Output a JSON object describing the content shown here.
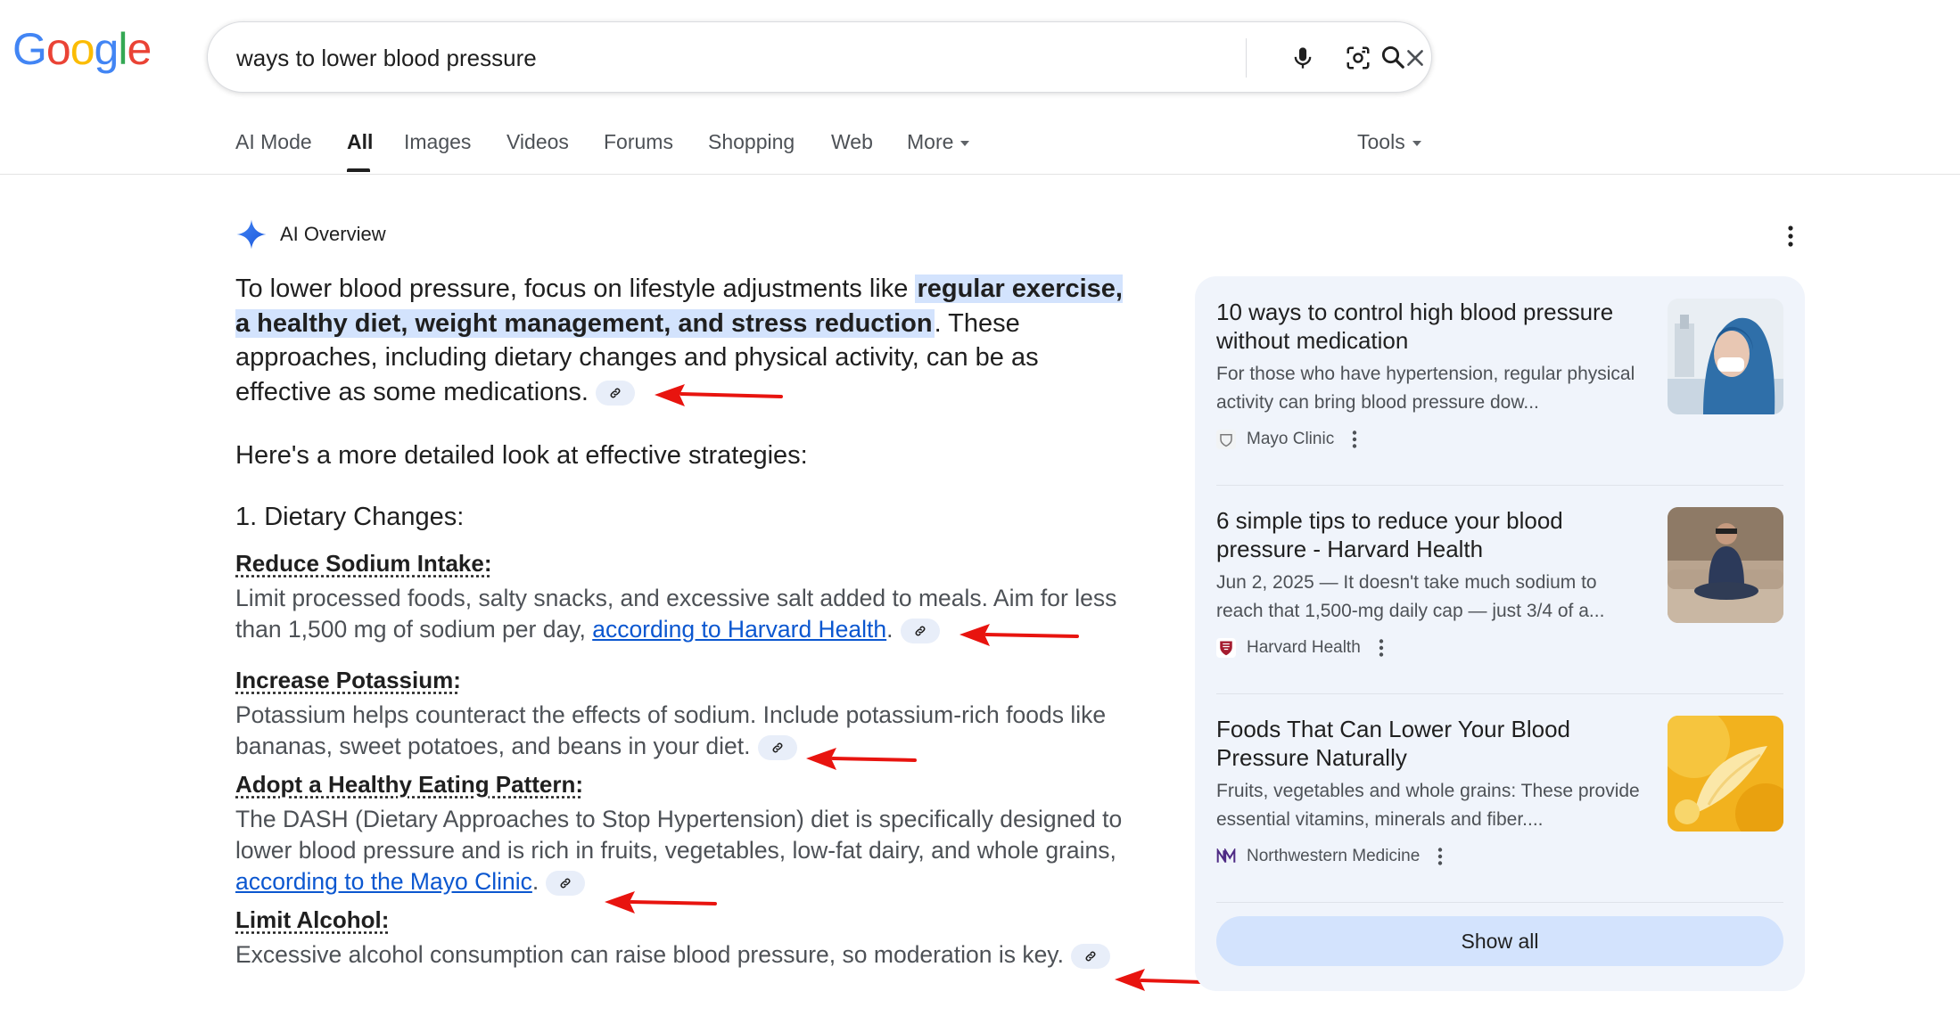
{
  "logo": {
    "letters": [
      "G",
      "o",
      "o",
      "g",
      "l",
      "e"
    ],
    "colors": [
      "#4285F4",
      "#EA4335",
      "#FBBC05",
      "#4285F4",
      "#34A853",
      "#EA4335"
    ]
  },
  "search": {
    "value": "ways to lower blood pressure",
    "clear_icon": "close-icon",
    "voice_icon": "microphone-icon",
    "lens_icon": "camera-lens-icon",
    "search_icon": "search-icon"
  },
  "tabs": [
    {
      "label": "AI Mode"
    },
    {
      "label": "All"
    },
    {
      "label": "Images"
    },
    {
      "label": "Videos"
    },
    {
      "label": "Forums"
    },
    {
      "label": "Shopping"
    },
    {
      "label": "Web"
    },
    {
      "label": "More"
    }
  ],
  "tools_label": "Tools",
  "ai_overview": {
    "title": "AI Overview",
    "intro_before": "To lower blood pressure, focus on lifestyle adjustments like ",
    "intro_highlight": "regular exercise, a healthy diet, weight management, and stress reduction",
    "intro_after": ". These approaches, including dietary changes and physical activity, can be as effective as some medications.",
    "detail_line": "Here's a more detailed look at effective strategies:",
    "section_heading": "1. Dietary Changes:",
    "items": [
      {
        "title": "Reduce Sodium Intake:",
        "body": "Limit processed foods, salty snacks, and excessive salt added to meals. Aim for less than 1,500 mg of sodium per day, ",
        "link": "according to Harvard Health",
        "tail": "."
      },
      {
        "title": "Increase Potassium:",
        "body": "Potassium helps counteract the effects of sodium. Include potassium-rich foods like bananas, sweet potatoes, and beans in your diet.",
        "link": "",
        "tail": ""
      },
      {
        "title": "Adopt a Healthy Eating Pattern:",
        "body": "The DASH (Dietary Approaches to Stop Hypertension) diet is specifically designed to lower blood pressure and is rich in fruits, vegetables, low-fat dairy, and whole grains, ",
        "link": "according to the Mayo Clinic",
        "tail": "."
      },
      {
        "title": "Limit Alcohol:",
        "body": "Excessive alcohol consumption can raise blood pressure, so moderation is key.",
        "link": "",
        "tail": ""
      }
    ]
  },
  "sources": [
    {
      "title": "10 ways to control high blood pressure without medication",
      "snippet": "For those who have hypertension, regular physical activity can bring blood pressure dow...",
      "source": "Mayo Clinic"
    },
    {
      "title": "6 simple tips to reduce your blood pressure - Harvard Health",
      "snippet": "Jun 2, 2025 — It doesn't take much sodium to reach that 1,500-mg daily cap — just 3/4 of a...",
      "source": "Harvard Health"
    },
    {
      "title": "Foods That Can Lower Your Blood Pressure Naturally",
      "snippet": "Fruits, vegetables and whole grains: These provide essential vitamins, minerals and fiber....",
      "source": "Northwestern Medicine"
    }
  ],
  "show_all_label": "Show all",
  "colors": {
    "accent": "#0b57d0",
    "highlight": "#d3e3fd",
    "panel": "#f0f4fb",
    "annotation_arrow": "#e8140f"
  }
}
